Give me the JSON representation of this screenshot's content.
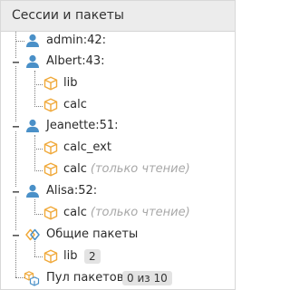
{
  "header": {
    "title": "Сессии и пакеты"
  },
  "sessions": [
    {
      "name": "admin:42:"
    },
    {
      "name": "Albert:43:",
      "packages": [
        {
          "name": "lib"
        },
        {
          "name": "calc"
        }
      ]
    },
    {
      "name": "Jeanette:51:",
      "packages": [
        {
          "name": "calc_ext"
        },
        {
          "name": "calc",
          "suffix": "(только чтение)"
        }
      ]
    },
    {
      "name": "Alisa:52:",
      "packages": [
        {
          "name": "calc",
          "suffix": "(только чтение)"
        }
      ]
    }
  ],
  "shared": {
    "title": "Общие пакеты",
    "packages": [
      {
        "name": "lib",
        "badge": "2"
      }
    ]
  },
  "pool": {
    "title": "Пул пакетов",
    "badge": "0 из 10"
  },
  "colors": {
    "user_icon": "#4a90c8",
    "package_icon": "#f0a93a",
    "tree_line": "#7d7d7d",
    "muted_text": "#a8a8a8"
  }
}
